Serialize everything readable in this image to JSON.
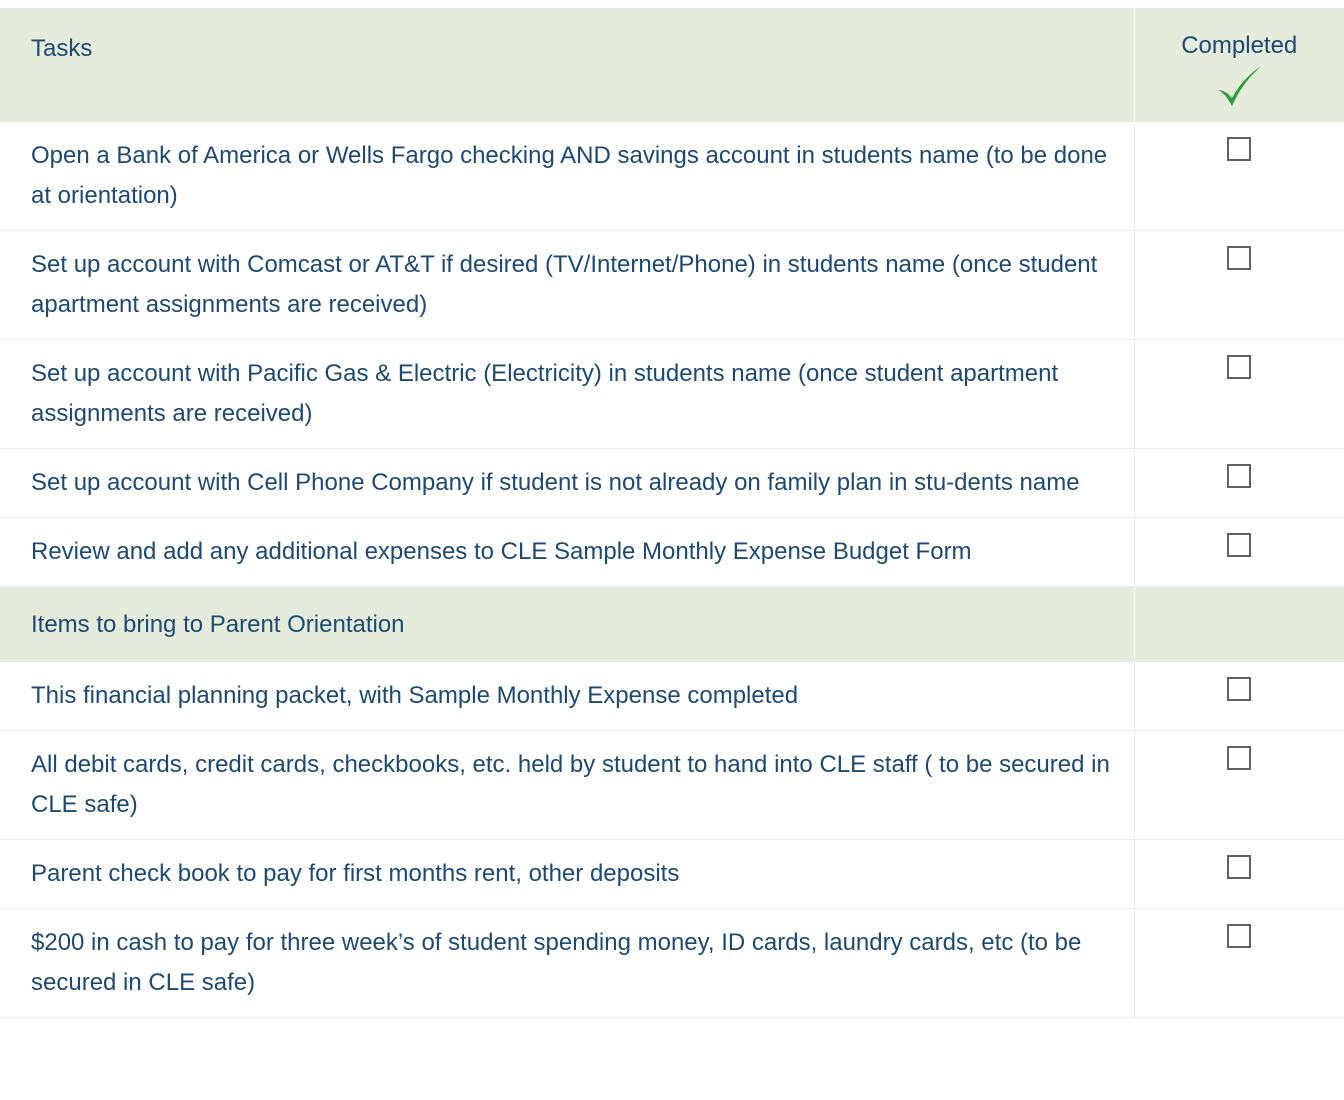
{
  "header": {
    "tasks_label": "Tasks",
    "completed_label": "Completed",
    "check_icon": "checkmark-icon",
    "check_color": "#2e9c3a"
  },
  "colors": {
    "text": "#1c4a73",
    "header_bg": "#e6ecdc",
    "border": "#e8ecee"
  },
  "tasks": [
    {
      "text": "Open a Bank of America or Wells Fargo checking AND savings account in students name (to be done at orientation)",
      "completed": false
    },
    {
      "text": "Set up account with Comcast or AT&T if desired (TV/Internet/Phone) in students name (once student apartment assignments are received)",
      "completed": false
    },
    {
      "text": "Set up account with Pacific Gas & Electric (Electricity) in students name (once student apartment assignments are received)",
      "completed": false
    },
    {
      "text": "Set up account with Cell Phone Company if student is not already on family plan in stu-dents name",
      "completed": false
    },
    {
      "text": "Review and add any additional expenses to CLE Sample Monthly Expense Budget Form",
      "completed": false
    }
  ],
  "section": {
    "label": "Items to bring to Parent Orientation"
  },
  "items": [
    {
      "text": "This financial planning packet, with Sample Monthly Expense completed",
      "completed": false
    },
    {
      "text": "All debit cards, credit cards, checkbooks, etc. held by student to hand into CLE staff ( to be secured in CLE safe)",
      "completed": false
    },
    {
      "text": "Parent check book to pay for first months rent, other deposits",
      "completed": false
    },
    {
      "text": "$200 in cash to pay for three week’s of student spending money, ID cards, laundry cards, etc (to be secured in CLE safe)",
      "completed": false
    }
  ]
}
